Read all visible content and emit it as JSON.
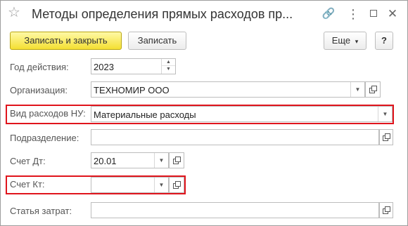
{
  "window": {
    "title": "Методы определения прямых расходов пр...",
    "star_icon": "☆",
    "link_icon": "🔗",
    "more_icon": "⋮",
    "close_icon": "✕"
  },
  "toolbar": {
    "save_close_label": "Записать и закрыть",
    "save_label": "Записать",
    "more_label": "Еще",
    "more_caret": "▾",
    "help_label": "?"
  },
  "form": {
    "year": {
      "label": "Год действия:",
      "value": "2023"
    },
    "organization": {
      "label": "Организация:",
      "value": "ТЕХНОМИР ООО"
    },
    "expense_type": {
      "label": "Вид расходов НУ:",
      "value": "Материальные расходы"
    },
    "department": {
      "label": "Подразделение:",
      "value": ""
    },
    "debit_account": {
      "label": "Счет Дт:",
      "value": "20.01"
    },
    "credit_account": {
      "label": "Счет Кт:",
      "value": ""
    },
    "cost_item": {
      "label": "Статья затрат:",
      "value": ""
    }
  },
  "glyphs": {
    "dropdown": "▼",
    "spin_up": "▲",
    "spin_down": "▼"
  },
  "colors": {
    "highlight": "#e0141c",
    "primary_button": "#f4df32"
  }
}
